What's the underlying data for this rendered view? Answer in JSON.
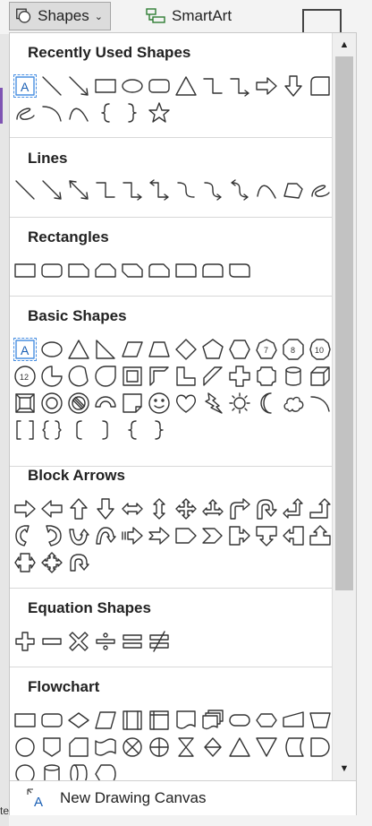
{
  "ribbon": {
    "shapes_label": "Shapes",
    "smartart_label": "SmartArt",
    "colors": {
      "selection": "#4a90e2",
      "stroke": "#333333"
    }
  },
  "sections": [
    {
      "title": "Recently Used Shapes",
      "icons": [
        "textbox",
        "line",
        "arrow-line",
        "rectangle",
        "oval",
        "rounded-rectangle",
        "triangle",
        "elbow-connector",
        "elbow-arrow-connector",
        "right-arrow",
        "down-arrow",
        "snip-corner",
        "freeform-scribble",
        "arc",
        "curve",
        "left-brace",
        "right-brace",
        "star"
      ]
    },
    {
      "title": "Lines",
      "icons": [
        "line",
        "arrow-line",
        "double-arrow-line",
        "elbow-connector",
        "elbow-arrow",
        "elbow-double-arrow",
        "curved-connector",
        "curved-arrow",
        "curved-double-arrow",
        "curve",
        "freeform",
        "scribble"
      ]
    },
    {
      "title": "Rectangles",
      "icons": [
        "rectangle",
        "rounded-rectangle",
        "snip-single-corner",
        "snip-same-side",
        "snip-diagonal",
        "snip-round-single",
        "round-single-corner",
        "round-same-side",
        "round-diagonal"
      ]
    },
    {
      "title": "Basic Shapes",
      "icons": [
        "textbox",
        "oval",
        "isosceles-triangle",
        "right-triangle",
        "parallelogram",
        "trapezoid",
        "diamond",
        "pentagon",
        "hexagon",
        "heptagon",
        "octagon",
        "decagon",
        "dodecagon",
        "pie",
        "chord",
        "teardrop",
        "frame",
        "half-frame",
        "l-shape",
        "diagonal-stripe",
        "cross",
        "plaque",
        "can",
        "cube",
        "bevel",
        "donut",
        "no-symbol",
        "block-arc",
        "folded-corner",
        "smiley",
        "heart",
        "lightning",
        "sun",
        "moon",
        "cloud",
        "arc",
        "double-bracket",
        "double-brace",
        "left-bracket",
        "right-bracket",
        "left-brace",
        "right-brace"
      ]
    },
    {
      "title": "Block Arrows",
      "icons": [
        "right-arrow",
        "left-arrow",
        "up-arrow",
        "down-arrow",
        "left-right-arrow",
        "up-down-arrow",
        "quad-arrow",
        "left-right-up-arrow",
        "bent-arrow",
        "u-turn-arrow",
        "left-up-arrow",
        "bent-up-arrow",
        "curved-right-arrow",
        "curved-left-arrow",
        "curved-up-arrow",
        "curved-down-arrow",
        "striped-right-arrow",
        "notched-right-arrow",
        "pentagon-arrow",
        "chevron",
        "right-arrow-callout",
        "down-arrow-callout",
        "left-arrow-callout",
        "up-arrow-callout",
        "left-right-arrow-callout",
        "quad-arrow-callout",
        "circular-arrow"
      ]
    },
    {
      "title": "Equation Shapes",
      "icons": [
        "plus",
        "minus",
        "multiply",
        "division",
        "equal",
        "not-equal"
      ]
    },
    {
      "title": "Flowchart",
      "icons": [
        "process",
        "alternate-process",
        "decision",
        "data",
        "predefined-process",
        "internal-storage",
        "document",
        "multidocument",
        "terminator",
        "preparation",
        "manual-input",
        "manual-operation",
        "connector",
        "off-page-connector",
        "card",
        "punched-tape",
        "summing-junction",
        "or",
        "collate",
        "sort",
        "extract",
        "merge",
        "stored-data",
        "delay",
        "sequential-access",
        "magnetic-disk",
        "direct-access",
        "display"
      ]
    }
  ],
  "footer": {
    "new_canvas_label": "New Drawing Canvas"
  },
  "scrollbar": {
    "up": "▲",
    "down": "▼"
  },
  "edge_texts": {
    "bottom_left": "te"
  }
}
